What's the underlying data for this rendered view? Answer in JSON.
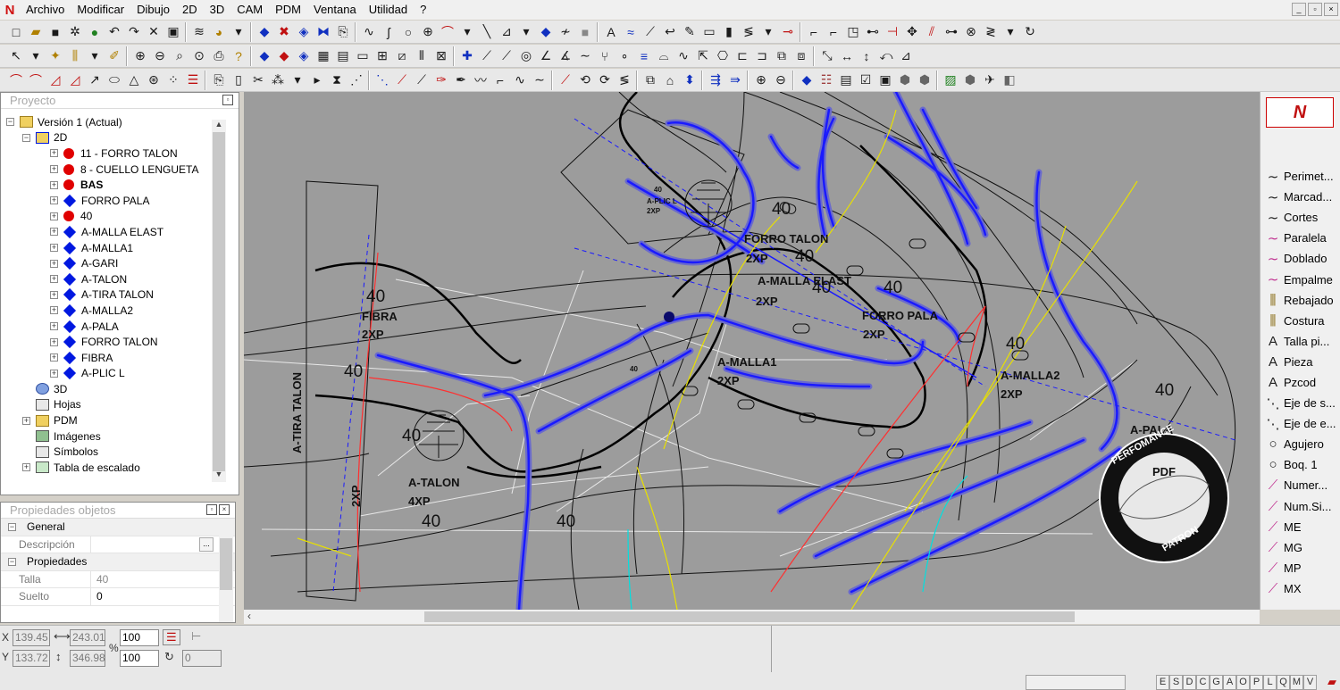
{
  "menu": {
    "items": [
      "Archivo",
      "Modificar",
      "Dibujo",
      "2D",
      "3D",
      "CAM",
      "PDM",
      "Ventana",
      "Utilidad",
      "?"
    ]
  },
  "window_controls": [
    "_",
    "▫",
    "×"
  ],
  "project_panel": {
    "title": "Proyecto",
    "tree": {
      "root": "Versión 1 (Actual)",
      "node_2d": "2D",
      "pieces": [
        {
          "label": "11 - FORRO TALON",
          "marker": "red-circle",
          "bold": false
        },
        {
          "label": "8 - CUELLO LENGUETA",
          "marker": "red-circle",
          "bold": false
        },
        {
          "label": "BAS",
          "marker": "red-circle",
          "bold": true
        },
        {
          "label": "FORRO PALA",
          "marker": "blue-diamond",
          "bold": false
        },
        {
          "label": "40",
          "marker": "red-circle",
          "bold": false
        },
        {
          "label": "A-MALLA ELAST",
          "marker": "blue-diamond",
          "bold": false
        },
        {
          "label": "A-MALLA1",
          "marker": "blue-diamond",
          "bold": false
        },
        {
          "label": "A-GARI",
          "marker": "blue-diamond",
          "bold": false
        },
        {
          "label": "A-TALON",
          "marker": "blue-diamond",
          "bold": false
        },
        {
          "label": "A-TIRA TALON",
          "marker": "blue-diamond",
          "bold": false
        },
        {
          "label": "A-MALLA2",
          "marker": "blue-diamond",
          "bold": false
        },
        {
          "label": "A-PALA",
          "marker": "blue-diamond",
          "bold": false
        },
        {
          "label": "FORRO TALON",
          "marker": "blue-diamond",
          "bold": false
        },
        {
          "label": "FIBRA",
          "marker": "blue-diamond",
          "bold": false
        },
        {
          "label": "A-PLIC L",
          "marker": "blue-diamond",
          "bold": false
        }
      ],
      "others": [
        "3D",
        "Hojas",
        "PDM",
        "Imágenes",
        "Símbolos",
        "Tabla de escalado"
      ]
    }
  },
  "properties_panel": {
    "title": "Propiedades objetos",
    "section_general": "General",
    "descripcion_label": "Descripción",
    "descripcion_value": "",
    "section_propiedades": "Propiedades",
    "talla_label": "Talla",
    "talla_value": "40",
    "suelto_label": "Suelto",
    "suelto_value": "0"
  },
  "canvas": {
    "labels": {
      "forro_talon": "FORRO TALON",
      "forro_talon_qty": "2XP",
      "malla_elast": "A-MALLA ELAST",
      "malla_elast_qty": "2XP",
      "forro_pala": "FORRO PALA",
      "forro_pala_qty": "2XP",
      "fibra": "FIBRA",
      "fibra_qty": "2XP",
      "malla1": "A-MALLA1",
      "malla1_qty": "2XP",
      "malla2": "A-MALLA2",
      "malla2_qty": "2XP",
      "talon": "A-TALON",
      "talon_qty": "4XP",
      "tira_talon": "A-TIRA TALON",
      "tira_talon_qty": "2XP",
      "pala": "A-PALA",
      "plic": "A-PLIC L",
      "plic_qty": "2XP",
      "size": "40"
    },
    "stamp": {
      "top": "PERFOMANCE",
      "middle": "PDF",
      "bottom": "PATRON"
    }
  },
  "right_panel": {
    "tools": [
      {
        "label": "Perimet...",
        "icon": "curve-icon"
      },
      {
        "label": "Marcad...",
        "icon": "curve-icon"
      },
      {
        "label": "Cortes",
        "icon": "curve-icon"
      },
      {
        "label": "Paralela",
        "icon": "curve-pink-icon"
      },
      {
        "label": "Doblado",
        "icon": "curve-pink-icon"
      },
      {
        "label": "Empalme",
        "icon": "curve-pink-icon"
      },
      {
        "label": "Rebajado",
        "icon": "stitch-icon"
      },
      {
        "label": "Costura",
        "icon": "stitch-icon"
      },
      {
        "label": "Talla pi...",
        "icon": "text-a-icon"
      },
      {
        "label": "Pieza",
        "icon": "text-a-icon"
      },
      {
        "label": "Pzcod",
        "icon": "text-a-icon"
      },
      {
        "label": "Eje de s...",
        "icon": "axis-icon"
      },
      {
        "label": "Eje de e...",
        "icon": "axis-icon"
      },
      {
        "label": "Agujero",
        "icon": "circle-icon"
      },
      {
        "label": "Boq. 1",
        "icon": "circle-icon"
      },
      {
        "label": "Numer...",
        "icon": "marker-pink-icon"
      },
      {
        "label": "Num.Si...",
        "icon": "marker-pink-icon"
      },
      {
        "label": "ME",
        "icon": "marker-pink-icon"
      },
      {
        "label": "MG",
        "icon": "marker-pink-icon"
      },
      {
        "label": "MP",
        "icon": "marker-pink-icon"
      },
      {
        "label": "MX",
        "icon": "marker-pink-icon"
      }
    ]
  },
  "statusbar": {
    "x_label": "X",
    "y_label": "Y",
    "x1": "139.45",
    "x2": "243.01",
    "y1": "133.72",
    "y2": "346.98",
    "percent": "%",
    "scale1": "100",
    "scale2": "100",
    "rotation": "0",
    "modes": [
      "E",
      "S",
      "D",
      "C",
      "G",
      "A",
      "O",
      "P",
      "L",
      "Q",
      "M",
      "V"
    ]
  },
  "colors": {
    "canvas_bg": "#9c9c9c",
    "piece_line": "#000000",
    "seam": "#1a1aff",
    "accent_red": "#e00000"
  }
}
